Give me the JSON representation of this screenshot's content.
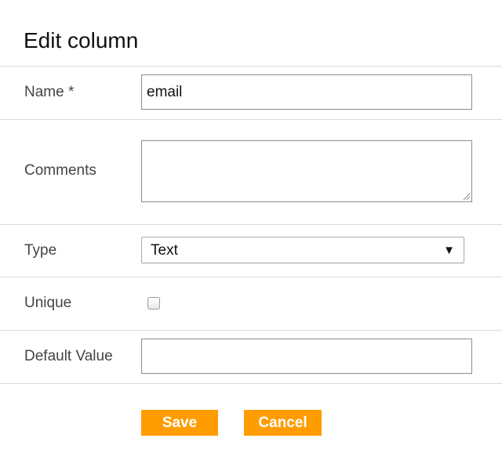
{
  "dialog": {
    "title": "Edit column"
  },
  "fields": {
    "name": {
      "label": "Name *",
      "value": "email"
    },
    "comments": {
      "label": "Comments",
      "value": ""
    },
    "type": {
      "label": "Type",
      "selected": "Text"
    },
    "unique": {
      "label": "Unique",
      "checked": false
    },
    "default_value": {
      "label": "Default Value",
      "value": ""
    }
  },
  "actions": {
    "save_label": "Save",
    "cancel_label": "Cancel"
  },
  "icons": {
    "dropdown": "dropdown-arrow-icon",
    "resize": "resize-grip-icon"
  },
  "colors": {
    "button_bg": "#ff9c00",
    "button_text": "#ffffff",
    "divider": "#d9d9d9"
  }
}
